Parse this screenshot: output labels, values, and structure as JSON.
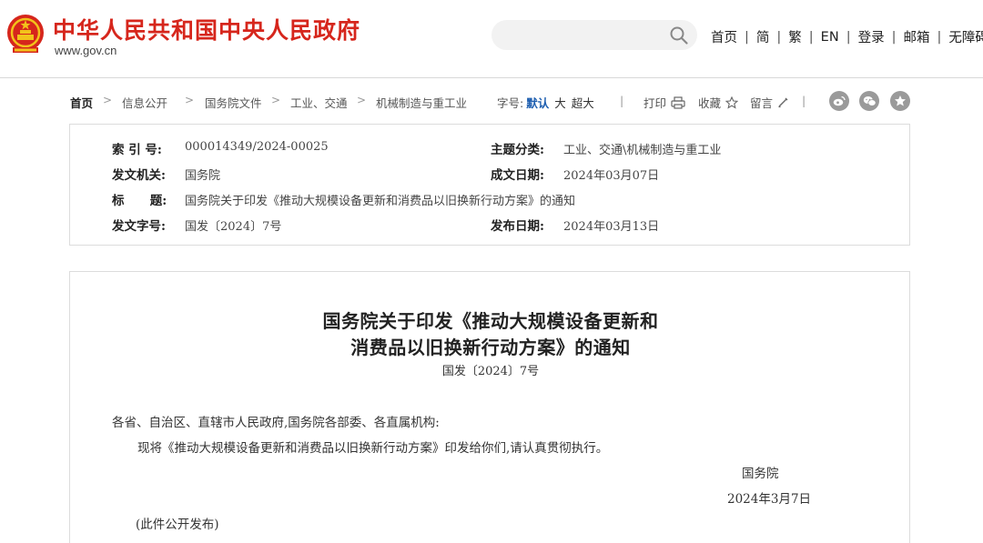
{
  "header": {
    "site_title": "中华人民共和国中央人民政府",
    "site_url": "www.gov.cn",
    "search_placeholder": "",
    "nav": [
      "首页",
      "简",
      "繁",
      "EN",
      "登录",
      "邮箱",
      "无障碍"
    ]
  },
  "breadcrumb": {
    "items": [
      "首页",
      "信息公开",
      "国务院文件",
      "工业、交通",
      "机械制造与重工业"
    ]
  },
  "toolbar": {
    "font_label": "字号:",
    "font_default": "默认",
    "font_large": "大",
    "font_xlarge": "超大",
    "print": "打印",
    "favorite": "收藏",
    "comment": "留言"
  },
  "info": {
    "index_label": "索 引 号:",
    "index_value": "000014349/2024-00025",
    "category_label": "主题分类:",
    "category_value": "工业、交通\\机械制造与重工业",
    "issuer_label": "发文机关:",
    "issuer_value": "国务院",
    "written_label": "成文日期:",
    "written_value": "2024年03月07日",
    "title_label": "标      题:",
    "title_value": "国务院关于印发《推动大规模设备更新和消费品以旧换新行动方案》的通知",
    "docno_label": "发文字号:",
    "docno_value": "国发〔2024〕7号",
    "published_label": "发布日期:",
    "published_value": "2024年03月13日"
  },
  "document": {
    "title_line1": "国务院关于印发《推动大规模设备更新和",
    "title_line2": "消费品以旧换新行动方案》的通知",
    "number": "国发〔2024〕7号",
    "salutation": "各省、自治区、直辖市人民政府,国务院各部委、各直属机构:",
    "body": "现将《推动大规模设备更新和消费品以旧换新行动方案》印发给你们,请认真贯彻执行。",
    "signature": "国务院",
    "date": "2024年3月7日",
    "note": "(此件公开发布)"
  },
  "colors": {
    "brand_red": "#d6261c",
    "accent_blue": "#1f5fb0",
    "border": "#dcdcdc"
  },
  "icons": [
    "national-emblem-icon",
    "search-icon",
    "printer-icon",
    "star-icon",
    "pencil-icon",
    "weibo-icon",
    "wechat-icon",
    "favorite-star-icon"
  ]
}
